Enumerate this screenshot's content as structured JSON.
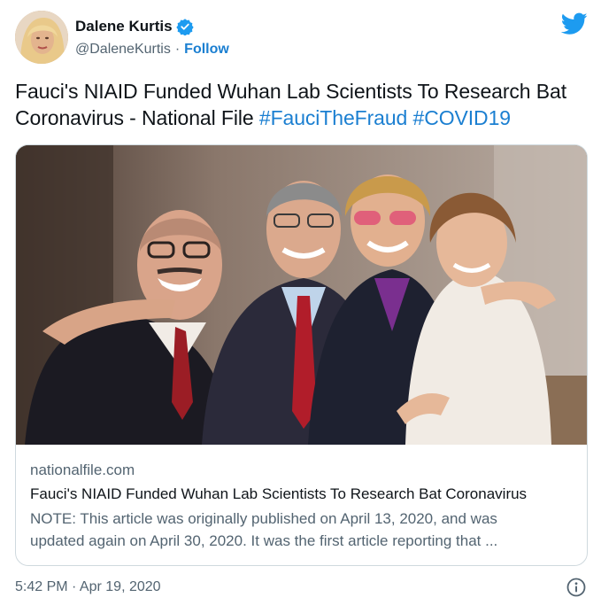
{
  "author": {
    "display_name": "Dalene Kurtis",
    "handle": "@DaleneKurtis",
    "separator": "·",
    "follow_label": "Follow",
    "verified_icon": "verified-badge-icon"
  },
  "tweet": {
    "text_plain": "Fauci's NIAID Funded Wuhan Lab Scientists To Research Bat Coronavirus - National File",
    "hashtags": [
      "#FauciTheFraud",
      "#COVID19"
    ]
  },
  "card": {
    "domain": "nationalfile.com",
    "title": "Fauci's NIAID Funded Wuhan Lab Scientists To Research Bat Coronavirus",
    "description_line1": "NOTE: This article was originally published on April 13, 2020, and was",
    "description_line2": "updated again on April 30, 2020. It was the first article reporting that ..."
  },
  "footer": {
    "timestamp": "5:42 PM · Apr 19, 2020",
    "info_icon": "info-icon"
  },
  "colors": {
    "accent": "#1b7fd1",
    "twitter_blue": "#1d9bf0",
    "text_primary": "#0f1419",
    "text_secondary": "#536471",
    "border": "#cfd9de"
  }
}
